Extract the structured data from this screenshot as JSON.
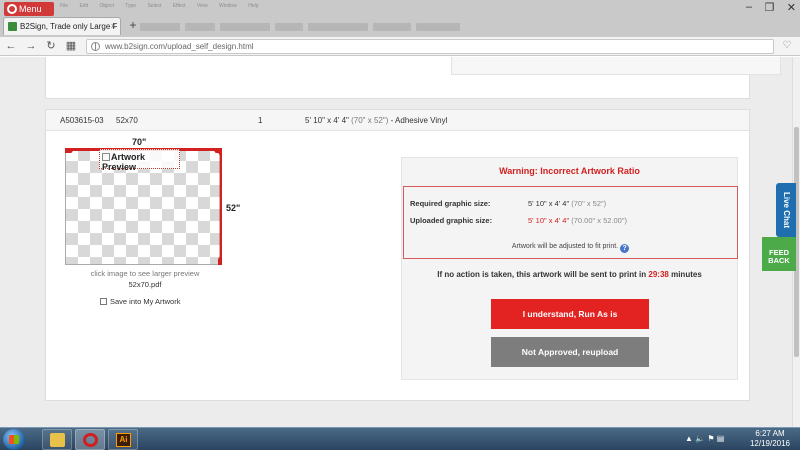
{
  "browser": {
    "menu_label": "Menu",
    "tab_title": "B2Sign, Trade only Large F",
    "tab_close": "×",
    "new_tab": "+",
    "window_controls": [
      "–",
      "❐",
      "✕"
    ],
    "background_menu_items": [
      "File",
      "Edit",
      "Object",
      "Type",
      "Select",
      "Effect",
      "View",
      "Window",
      "Help"
    ],
    "url": "www.b2sign.com/upload_self_design.html",
    "nav_icons": [
      "arrow-left-icon",
      "arrow-right-icon",
      "reload-icon",
      "home-grid-icon"
    ]
  },
  "order_row": {
    "order_id": "A503615-03",
    "file_size": "52x70",
    "quantity": "1",
    "product_size": "5' 10\" x 4' 4\"",
    "product_size_inches": "(70\" x 52\")",
    "product_material": " - Adhesive Vinyl"
  },
  "preview": {
    "width_label": "70\"",
    "height_label": "52\"",
    "alt_text": "Artwork Preview",
    "hint": "click image to see larger preview",
    "filename": "52x70.pdf",
    "save_label": "Save into My Artwork"
  },
  "warning": {
    "title": "Warning: Incorrect Artwork Ratio",
    "required_label": "Required graphic size:",
    "required_value": "5' 10\" x 4' 4\"",
    "required_value_inches": "(70\" x 52\")",
    "uploaded_label": "Uploaded graphic size:",
    "uploaded_value": "5' 10\" x 4' 4\"",
    "uploaded_value_inches": "(70.00\" x 52.00\")",
    "adjust_note": "Artwork will be adjusted to fit print.",
    "help_glyph": "?",
    "notice_prefix": "If no action is taken, this artwork will be sent to print in",
    "timer": "29:38",
    "notice_suffix": "minutes",
    "run_button": "I understand, Run As is",
    "reupload_button": "Not Approved, reupload"
  },
  "side_widgets": {
    "live_chat": "Live Chat",
    "feedback_line1": "FEED",
    "feedback_line2": "BACK"
  },
  "taskbar": {
    "time": "6:27 AM",
    "date": "12/19/2016",
    "app_label_ai": "Ai",
    "tray_icons": [
      "chevron-up-icon",
      "volume-icon",
      "flag-icon",
      "network-icon"
    ]
  },
  "colors": {
    "accent_red": "#e32222",
    "warning_red": "#d32020",
    "neutral_button": "#7d7d7d",
    "live_chat_blue": "#1f6fb0",
    "feedback_green": "#4caa48"
  }
}
